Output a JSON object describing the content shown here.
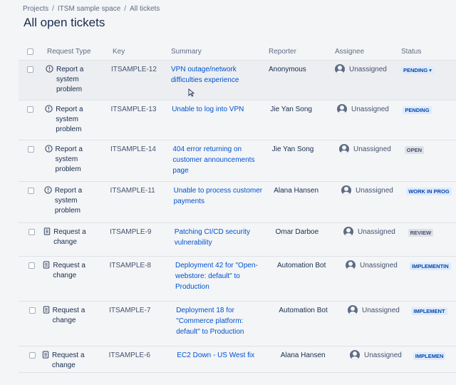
{
  "breadcrumb": {
    "items": [
      "Projects",
      "ITSM sample space",
      "All tickets"
    ],
    "separator": "/"
  },
  "page_title": "All open tickets",
  "columns": {
    "request_type": "Request Type",
    "key": "Key",
    "summary": "Summary",
    "reporter": "Reporter",
    "assignee": "Assignee",
    "status": "Status"
  },
  "rows": [
    {
      "type_line1": "Report a",
      "type_line2": "system",
      "type_line3": "problem",
      "type_icon": "alert-icon",
      "key": "ITSAMPLE-12",
      "summary": "VPN outage/network difficulties experience",
      "reporter": "Anonymous",
      "assignee": "Unassigned",
      "status": "PENDING",
      "status_has_dropdown": true,
      "status_color": "blue"
    },
    {
      "type_line1": "Report a",
      "type_line2": "system",
      "type_line3": "problem",
      "type_icon": "alert-icon",
      "key": "ITSAMPLE-13",
      "summary": "Unable to log into VPN",
      "reporter": "Jie Yan Song",
      "assignee": "Unassigned",
      "status": "PENDING",
      "status_color": "blue"
    },
    {
      "type_line1": "Report a",
      "type_line2": "system",
      "type_line3": "problem",
      "type_icon": "alert-icon",
      "key": "ITSAMPLE-14",
      "summary": "404 error returning on customer announcements page",
      "reporter": "Jie Yan Song",
      "assignee": "Unassigned",
      "status": "OPEN",
      "status_color": "gray"
    },
    {
      "type_line1": "Report a",
      "type_line2": "system",
      "type_line3": "problem",
      "type_icon": "alert-icon",
      "key": "ITSAMPLE-11",
      "summary": "Unable to process customer payments",
      "reporter": "Alana Hansen",
      "assignee": "Unassigned",
      "status": "WORK IN PROG",
      "status_color": "blue"
    },
    {
      "type_line1": "Request a",
      "type_line2": "change",
      "type_line3": "",
      "type_icon": "document-icon",
      "key": "ITSAMPLE-9",
      "summary": "Patching CI/CD security vulnerability",
      "reporter": "Omar Darboe",
      "assignee": "Unassigned",
      "status": "REVIEW",
      "status_color": "gray"
    },
    {
      "type_line1": "Request a",
      "type_line2": "change",
      "type_line3": "",
      "type_icon": "document-icon",
      "key": "ITSAMPLE-8",
      "summary": "Deployment 42 for \"Open-webstore: default\" to Production",
      "reporter": "Automation Bot",
      "assignee": "Unassigned",
      "status": "IMPLEMENTIN",
      "status_color": "blue"
    },
    {
      "type_line1": "Request a",
      "type_line2": "change",
      "type_line3": "",
      "type_icon": "document-icon",
      "key": "ITSAMPLE-7",
      "summary": "Deployment 18 for \"Commerce platform: default\" to Production",
      "reporter": "Automation Bot",
      "assignee": "Unassigned",
      "status": "IMPLEMENT",
      "status_color": "blue"
    },
    {
      "type_line1": "Request a",
      "type_line2": "change",
      "type_line3": "",
      "type_icon": "document-icon",
      "key": "ITSAMPLE-6",
      "summary": "EC2 Down - US West fix",
      "reporter": "Alana Hansen",
      "assignee": "Unassigned",
      "status": "IMPLEMEN",
      "status_color": "blue"
    }
  ]
}
